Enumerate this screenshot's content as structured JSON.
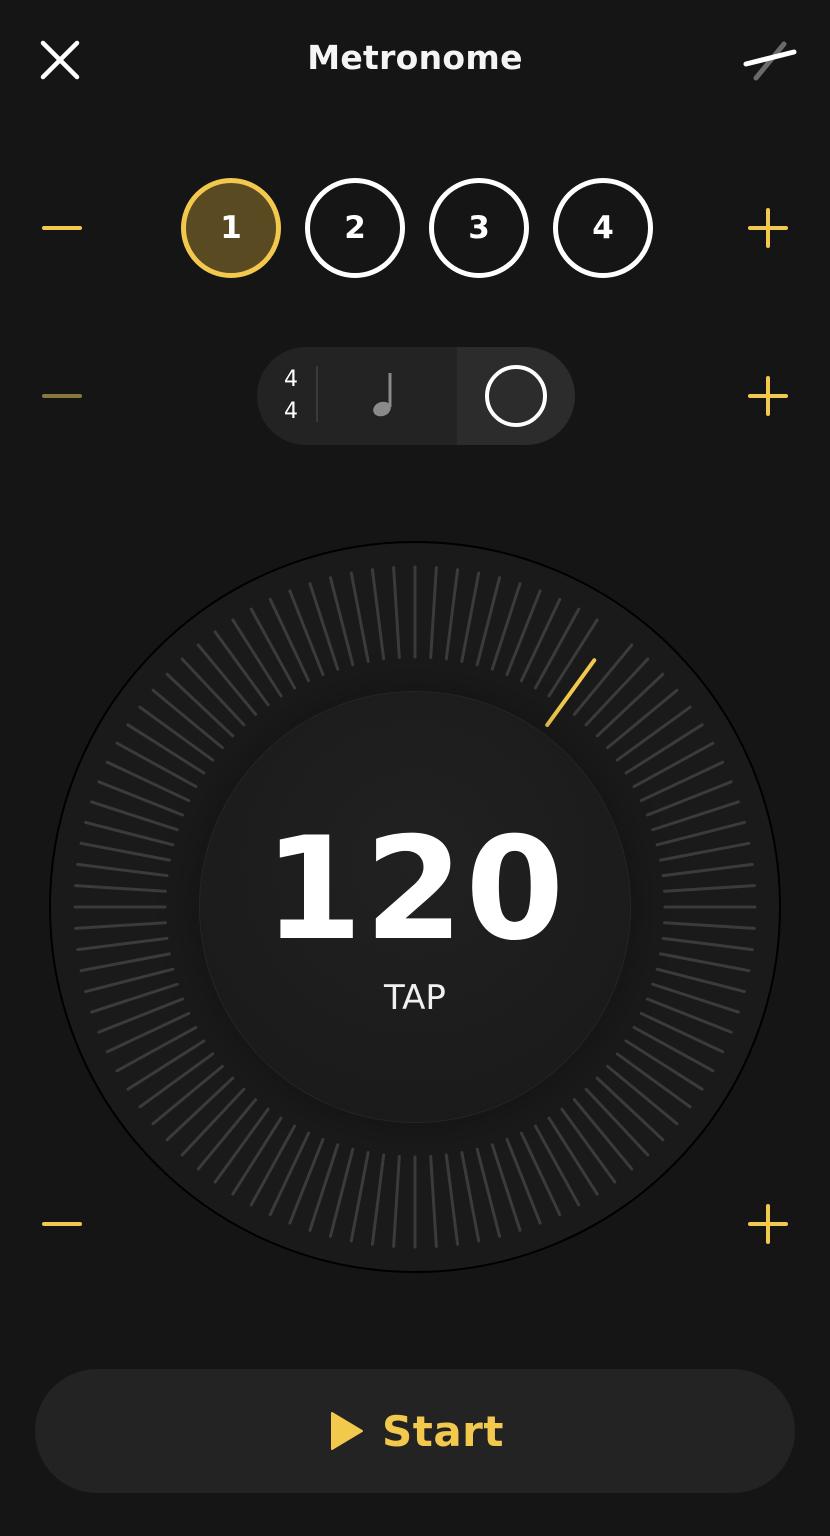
{
  "header": {
    "title": "Metronome"
  },
  "beats": {
    "items": [
      "1",
      "2",
      "3",
      "4"
    ],
    "active_index": 0
  },
  "time_signature": {
    "numerator": "4",
    "denominator": "4",
    "note_value": "quarter-note",
    "accent": "circle"
  },
  "tempo": {
    "bpm": "120",
    "tap_label": "TAP",
    "dial_ticks": 100,
    "dial_indicator_fraction": 0.1
  },
  "controls": {
    "start_label": "Start"
  },
  "icons": {
    "close": "close-icon",
    "edit": "slash-edit-icon",
    "minus": "minus-icon",
    "plus": "plus-icon",
    "play": "play-icon"
  },
  "colors": {
    "background": "#151515",
    "accent": "#f2c94c",
    "accent_dim": "#8a7640",
    "active_beat_fill": "#5a4a22",
    "pill": "#232323",
    "tick": "#3b3b3b"
  }
}
